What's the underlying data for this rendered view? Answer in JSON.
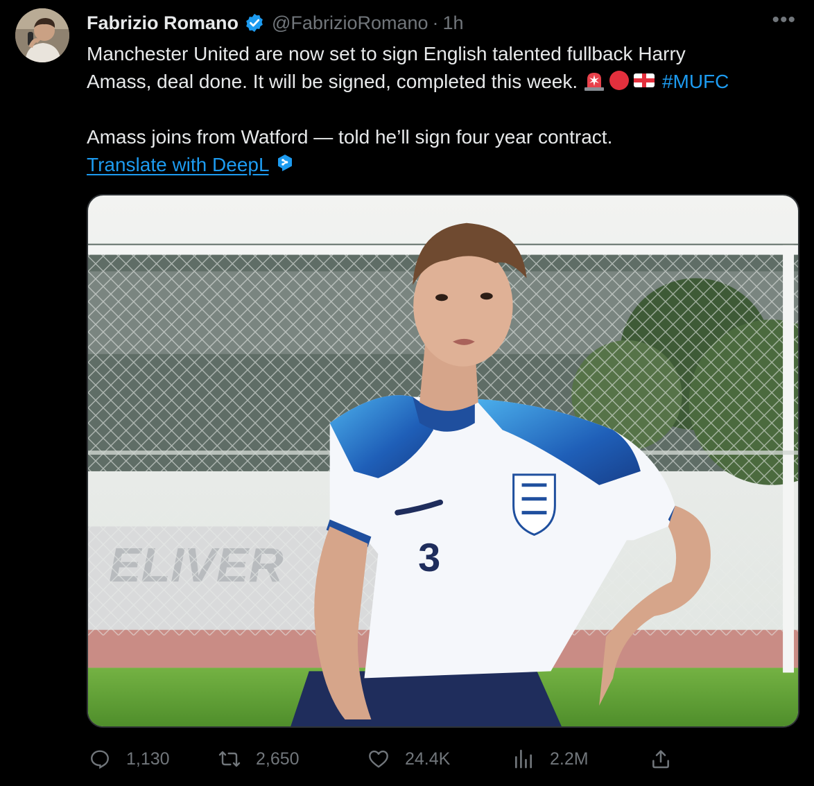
{
  "author": {
    "display_name": "Fabrizio Romano",
    "handle": "@FabrizioRomano",
    "separator": "·",
    "time_ago": "1h",
    "verified": true,
    "avatar_icon": "profile-photo"
  },
  "menu": {
    "more_label": "•••"
  },
  "tweet": {
    "line1": "Manchester United are now set to sign English talented fullback Harry",
    "line2": "Amass, deal done. It will be signed, completed this week.",
    "emojis": [
      "police-light-emoji",
      "red-circle-emoji",
      "england-flag-emoji"
    ],
    "hashtag": "#MUFC",
    "line3": "Amass joins from Watford — told he’ll sign four year contract.",
    "translate_label": "Translate with DeepL"
  },
  "media": {
    "alt": "Player in England shirt number 3",
    "kit_number": "3"
  },
  "stats": {
    "replies": "1,130",
    "reposts": "2,650",
    "likes": "24.4K",
    "views": "2.2M"
  },
  "colors": {
    "background": "#000000",
    "text": "#e7e9ea",
    "secondary": "#71767b",
    "accent": "#1d9bf0"
  }
}
